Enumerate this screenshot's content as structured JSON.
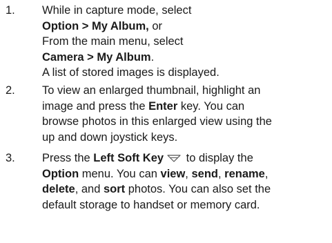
{
  "steps": [
    {
      "number": "1.",
      "lines": [
        {
          "parts": [
            {
              "text": "While in capture mode, select",
              "bold": false
            }
          ]
        },
        {
          "parts": [
            {
              "text": "Option > My Album,",
              "bold": true
            },
            {
              "text": " or",
              "bold": false
            }
          ]
        },
        {
          "parts": [
            {
              "text": "From the main menu, select",
              "bold": false
            }
          ]
        },
        {
          "parts": [
            {
              "text": "Camera > My Album",
              "bold": true
            },
            {
              "text": ".",
              "bold": false
            }
          ]
        },
        {
          "parts": [
            {
              "text": "A list of stored images is displayed.",
              "bold": false
            }
          ]
        }
      ]
    },
    {
      "number": "2.",
      "lines": [
        {
          "parts": [
            {
              "text": "To view an enlarged thumbnail, highlight an",
              "bold": false
            }
          ]
        },
        {
          "parts": [
            {
              "text": "image and press the ",
              "bold": false
            },
            {
              "text": "Enter",
              "bold": true
            },
            {
              "text": " key. You can",
              "bold": false
            }
          ]
        },
        {
          "parts": [
            {
              "text": "browse photos in this enlarged view using the",
              "bold": false
            }
          ]
        },
        {
          "parts": [
            {
              "text": "up and down joystick keys.",
              "bold": false
            }
          ]
        }
      ]
    },
    {
      "number": "3.",
      "lines": [
        {
          "parts": [
            {
              "text": "Press the ",
              "bold": false
            },
            {
              "text": "Left Soft Key",
              "bold": true
            },
            {
              "icon": "left-soft-key-icon"
            },
            {
              "text": " to display the",
              "bold": false
            }
          ]
        },
        {
          "parts": [
            {
              "text": "Option",
              "bold": true
            },
            {
              "text": " menu. You can ",
              "bold": false
            },
            {
              "text": "view",
              "bold": true
            },
            {
              "text": ", ",
              "bold": false
            },
            {
              "text": "send",
              "bold": true
            },
            {
              "text": ", ",
              "bold": false
            },
            {
              "text": "rename",
              "bold": true
            },
            {
              "text": ",",
              "bold": false
            }
          ]
        },
        {
          "parts": [
            {
              "text": "delete",
              "bold": true
            },
            {
              "text": ", and ",
              "bold": false
            },
            {
              "text": "sort",
              "bold": true
            },
            {
              "text": " photos. You can also set the",
              "bold": false
            }
          ]
        },
        {
          "parts": [
            {
              "text": "default storage to handset or memory card.",
              "bold": false
            }
          ]
        }
      ]
    }
  ]
}
